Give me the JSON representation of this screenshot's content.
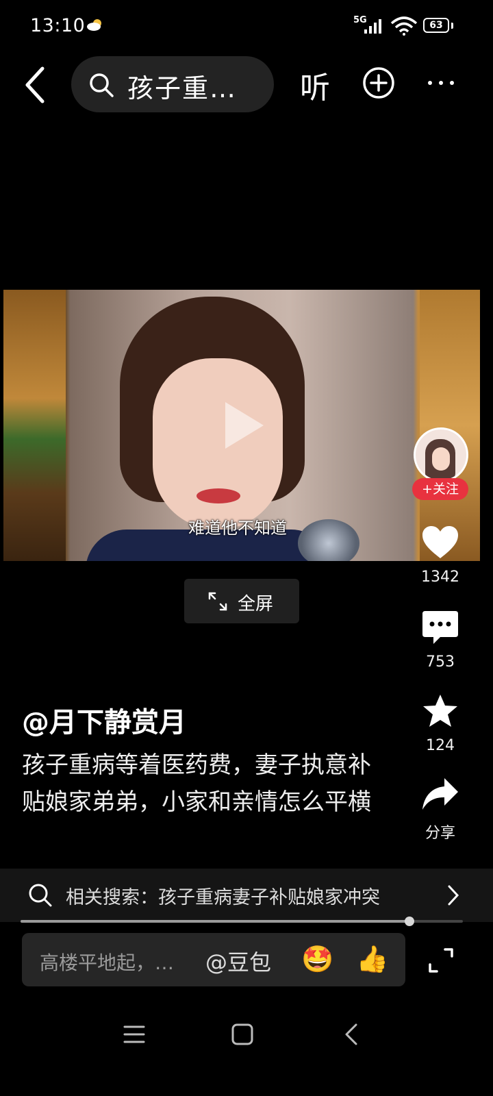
{
  "status_bar": {
    "time": "13:10",
    "network": "5G",
    "battery": "63",
    "icons": [
      "weather-icon",
      "signal-icon",
      "wifi-icon",
      "battery-icon"
    ]
  },
  "top_nav": {
    "search_text": "孩子重…",
    "listen_label": "听",
    "icons": [
      "back-icon",
      "search-icon",
      "plus-circle-icon",
      "more-icon"
    ]
  },
  "video": {
    "subtitle": "难道他不知道",
    "fullscreen_label": "全屏"
  },
  "author_panel": {
    "follow_label": "+关注"
  },
  "actions": {
    "like_count": "1342",
    "comment_count": "753",
    "favorite_count": "124",
    "share_label": "分享"
  },
  "caption": {
    "author": "@月下静赏月",
    "description": "孩子重病等着医药费，妻子执意补贴娘家弟弟，小家和亲情怎么平横"
  },
  "related": {
    "text": "相关搜索：孩子重病妻子补贴娘家冲突"
  },
  "playback": {
    "progress": 0.88
  },
  "comment_bar": {
    "placeholder": "高楼平地起，…",
    "mention": "@豆包",
    "emoji_star_eyes": "🤩",
    "emoji_thumbs_up": "👍"
  },
  "colors": {
    "background": "#000000",
    "follow_red": "#e8323f",
    "panel_dark": "#232323"
  }
}
